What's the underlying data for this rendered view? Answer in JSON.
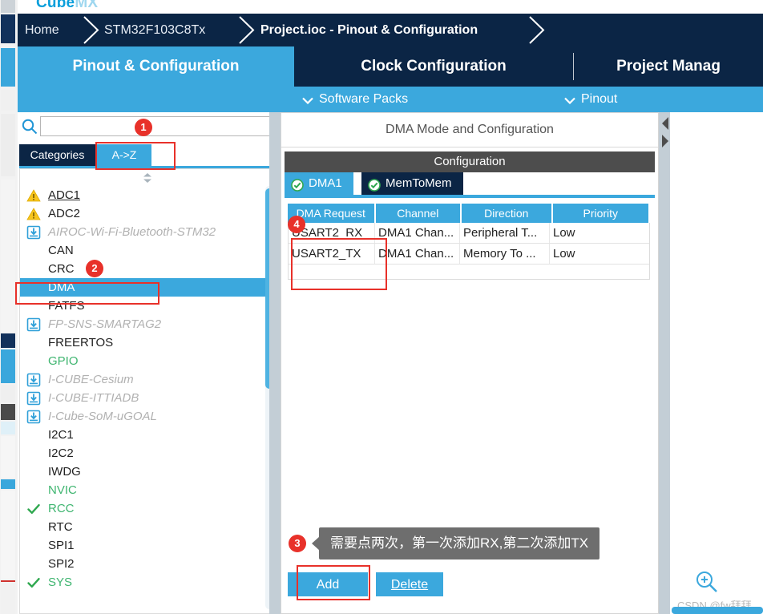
{
  "app": {
    "logo_cube": "Cube",
    "logo_mx": "MX"
  },
  "breadcrumb": {
    "items": [
      {
        "label": "Home"
      },
      {
        "label": "STM32F103C8Tx"
      },
      {
        "label": "Project.ioc - Pinout & Configuration"
      }
    ]
  },
  "tabs": [
    {
      "label": "Pinout & Configuration",
      "active": true
    },
    {
      "label": "Clock Configuration",
      "active": false
    },
    {
      "label": "Project Manag",
      "active": false
    }
  ],
  "subbar": [
    {
      "label": "Software Packs",
      "icon": "chevron-down-icon"
    },
    {
      "label": "Pinout",
      "icon": "chevron-down-icon"
    }
  ],
  "sidebar": {
    "search": {
      "value": "",
      "placeholder": "",
      "icon": "search-icon"
    },
    "view_tabs": [
      {
        "label": "Categories",
        "active": false
      },
      {
        "label": "A->Z",
        "active": true
      }
    ],
    "items": [
      {
        "label": "ADC1",
        "icon": "warning-icon",
        "style": "underline"
      },
      {
        "label": "ADC2",
        "icon": "warning-icon",
        "style": "normal"
      },
      {
        "label": "AIROC-Wi-Fi-Bluetooth-STM32",
        "icon": "download-icon",
        "style": "dim"
      },
      {
        "label": "CAN",
        "icon": "none",
        "style": "normal"
      },
      {
        "label": "CRC",
        "icon": "none",
        "style": "normal"
      },
      {
        "label": "DMA",
        "icon": "none",
        "style": "selected"
      },
      {
        "label": "FATFS",
        "icon": "none",
        "style": "normal"
      },
      {
        "label": "FP-SNS-SMARTAG2",
        "icon": "download-icon",
        "style": "dim"
      },
      {
        "label": "FREERTOS",
        "icon": "none",
        "style": "normal"
      },
      {
        "label": "GPIO",
        "icon": "none",
        "style": "green"
      },
      {
        "label": "I-CUBE-Cesium",
        "icon": "download-icon",
        "style": "dim"
      },
      {
        "label": "I-CUBE-ITTIADB",
        "icon": "download-icon",
        "style": "dim"
      },
      {
        "label": "I-Cube-SoM-uGOAL",
        "icon": "download-icon",
        "style": "dim"
      },
      {
        "label": "I2C1",
        "icon": "none",
        "style": "normal"
      },
      {
        "label": "I2C2",
        "icon": "none",
        "style": "normal"
      },
      {
        "label": "IWDG",
        "icon": "none",
        "style": "normal"
      },
      {
        "label": "NVIC",
        "icon": "none",
        "style": "green"
      },
      {
        "label": "RCC",
        "icon": "check-icon",
        "style": "green"
      },
      {
        "label": "RTC",
        "icon": "none",
        "style": "normal"
      },
      {
        "label": "SPI1",
        "icon": "none",
        "style": "normal"
      },
      {
        "label": "SPI2",
        "icon": "none",
        "style": "normal"
      },
      {
        "label": "SYS",
        "icon": "check-icon",
        "style": "green"
      }
    ]
  },
  "config": {
    "panel_title": "DMA Mode and Configuration",
    "section_header": "Configuration",
    "tabs": [
      {
        "label": "DMA1",
        "icon": "check-circle-icon",
        "active": true
      },
      {
        "label": "MemToMem",
        "icon": "check-circle-icon",
        "active": false
      }
    ],
    "table": {
      "columns": [
        "DMA Request",
        "Channel",
        "Direction",
        "Priority"
      ],
      "rows": [
        [
          "USART2_RX",
          "DMA1 Chan...",
          "Peripheral T...",
          "Low"
        ],
        [
          "USART2_TX",
          "DMA1 Chan...",
          "Memory To ...",
          "Low"
        ]
      ]
    },
    "buttons": {
      "add": "Add",
      "delete": "Delete"
    }
  },
  "tooltip": {
    "text": "需要点两次，第一次添加RX,第二次添加TX"
  },
  "annotations": {
    "markers": [
      {
        "number": "1"
      },
      {
        "number": "2"
      },
      {
        "number": "3"
      },
      {
        "number": "4"
      }
    ]
  },
  "footer": {
    "watermark": "CSDN @fw拜拜",
    "zoom_icon": "zoom-in-icon"
  },
  "colors": {
    "navy": "#0b2545",
    "accent_blue": "#3ba8dd",
    "annotation_red": "#e8312a",
    "green": "#3fb570",
    "warning_yellow": "#f5c518",
    "tooltip_gray": "#6e6e6e"
  }
}
